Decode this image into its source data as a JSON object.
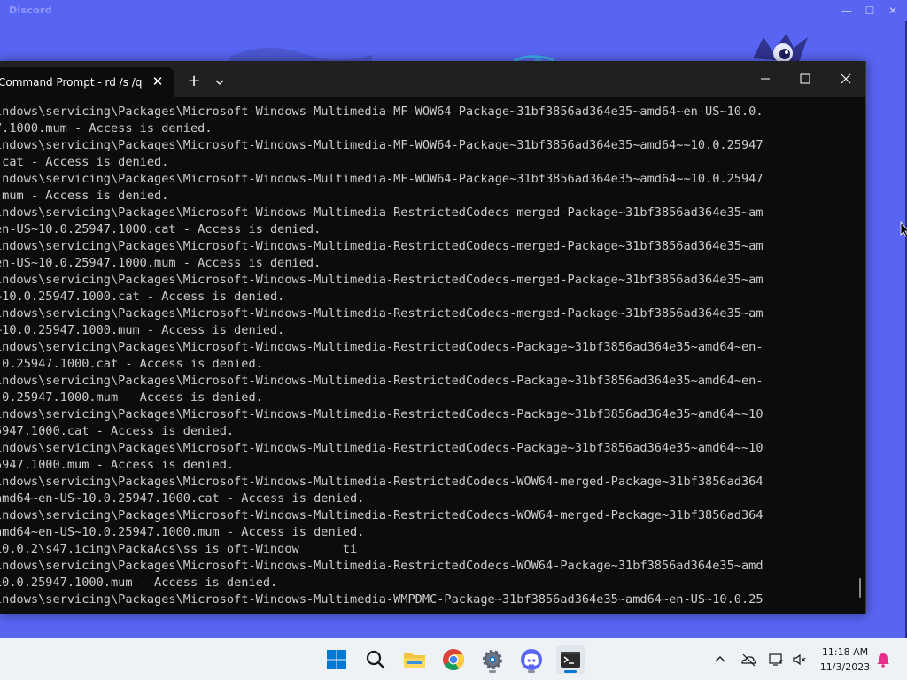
{
  "discord": {
    "title": "Discord",
    "minimize_glyph": "—",
    "maximize_glyph": "☐",
    "close_glyph": "✕"
  },
  "terminal": {
    "tab_title": "Command Prompt - rd  /s /q c",
    "tab_close_glyph": "✕",
    "new_tab_glyph": "+",
    "lines": [
      "indows\\servicing\\Packages\\Microsoft-Windows-Multimedia-MF-WOW64-Package~31bf3856ad364e35~amd64~en-US~10.0.",
      "7.1000.mum - Access is denied.",
      "indows\\servicing\\Packages\\Microsoft-Windows-Multimedia-MF-WOW64-Package~31bf3856ad364e35~amd64~~10.0.25947",
      ".cat - Access is denied.",
      "indows\\servicing\\Packages\\Microsoft-Windows-Multimedia-MF-WOW64-Package~31bf3856ad364e35~amd64~~10.0.25947",
      ".mum - Access is denied.",
      "indows\\servicing\\Packages\\Microsoft-Windows-Multimedia-RestrictedCodecs-merged-Package~31bf3856ad364e35~am",
      "en-US~10.0.25947.1000.cat - Access is denied.",
      "indows\\servicing\\Packages\\Microsoft-Windows-Multimedia-RestrictedCodecs-merged-Package~31bf3856ad364e35~am",
      "en-US~10.0.25947.1000.mum - Access is denied.",
      "indows\\servicing\\Packages\\Microsoft-Windows-Multimedia-RestrictedCodecs-merged-Package~31bf3856ad364e35~am",
      "~10.0.25947.1000.cat - Access is denied.",
      "indows\\servicing\\Packages\\Microsoft-Windows-Multimedia-RestrictedCodecs-merged-Package~31bf3856ad364e35~am",
      "~10.0.25947.1000.mum - Access is denied.",
      "indows\\servicing\\Packages\\Microsoft-Windows-Multimedia-RestrictedCodecs-Package~31bf3856ad364e35~amd64~en-",
      ".0.25947.1000.cat - Access is denied.",
      "indows\\servicing\\Packages\\Microsoft-Windows-Multimedia-RestrictedCodecs-Package~31bf3856ad364e35~amd64~en-",
      ".0.25947.1000.mum - Access is denied.",
      "indows\\servicing\\Packages\\Microsoft-Windows-Multimedia-RestrictedCodecs-Package~31bf3856ad364e35~amd64~~10",
      "5947.1000.cat - Access is denied.",
      "indows\\servicing\\Packages\\Microsoft-Windows-Multimedia-RestrictedCodecs-Package~31bf3856ad364e35~amd64~~10",
      "5947.1000.mum - Access is denied.",
      "indows\\servicing\\Packages\\Microsoft-Windows-Multimedia-RestrictedCodecs-WOW64-merged-Package~31bf3856ad364",
      "amd64~en-US~10.0.25947.1000.cat - Access is denied.",
      "indows\\servicing\\Packages\\Microsoft-Windows-Multimedia-RestrictedCodecs-WOW64-merged-Package~31bf3856ad364",
      "amd64~en-US~10.0.25947.1000.mum - Access is denied.",
      "10.0.2\\s47.icing\\PackaAcs\\ss is oft-Window      ti",
      "indows\\servicing\\Packages\\Microsoft-Windows-Multimedia-RestrictedCodecs-WOW64-Package~31bf3856ad364e35~amd",
      "10.0.25947.1000.mum - Access is denied.",
      "indows\\servicing\\Packages\\Microsoft-Windows-Multimedia-WMPDMC-Package~31bf3856ad364e35~amd64~en-US~10.0.25"
    ]
  },
  "taskbar": {
    "apps": [
      {
        "name": "Start",
        "icon": "windows-logo-icon"
      },
      {
        "name": "Search",
        "icon": "search-icon"
      },
      {
        "name": "File Explorer",
        "icon": "folder-icon"
      },
      {
        "name": "Google Chrome",
        "icon": "chrome-icon"
      },
      {
        "name": "Settings",
        "icon": "gear-icon"
      },
      {
        "name": "Discord",
        "icon": "discord-icon"
      },
      {
        "name": "Terminal",
        "icon": "terminal-icon"
      }
    ],
    "clock": {
      "time": "11:18 AM",
      "date": "11/3/2023"
    },
    "colors": {
      "windows_blue": "#0078d4",
      "discord_blurple": "#5865f2",
      "folder_yellow": "#f5c242"
    }
  }
}
